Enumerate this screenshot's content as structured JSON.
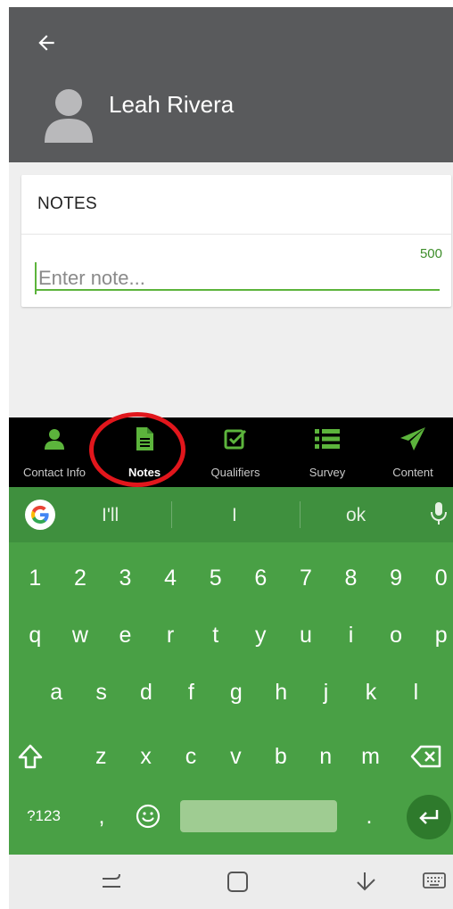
{
  "header": {
    "contact_name": "Leah Rivera"
  },
  "notes": {
    "title": "NOTES",
    "char_count": "500",
    "placeholder": "Enter note..."
  },
  "bottom_nav": [
    {
      "label": "Contact Info",
      "icon": "person-icon",
      "active": false
    },
    {
      "label": "Notes",
      "icon": "document-icon",
      "active": true
    },
    {
      "label": "Qualifiers",
      "icon": "checkbox-icon",
      "active": false
    },
    {
      "label": "Survey",
      "icon": "list-icon",
      "active": false
    },
    {
      "label": "Content",
      "icon": "send-icon",
      "active": false
    }
  ],
  "keyboard": {
    "suggestions": [
      "I'll",
      "I",
      "ok"
    ],
    "number_row": [
      "1",
      "2",
      "3",
      "4",
      "5",
      "6",
      "7",
      "8",
      "9",
      "0"
    ],
    "row1": [
      "q",
      "w",
      "e",
      "r",
      "t",
      "y",
      "u",
      "i",
      "o",
      "p"
    ],
    "row2": [
      "a",
      "s",
      "d",
      "f",
      "g",
      "h",
      "j",
      "k",
      "l"
    ],
    "row3": [
      "z",
      "x",
      "c",
      "v",
      "b",
      "n",
      "m"
    ],
    "symbols_key": "?123",
    "comma_key": ",",
    "period_key": "."
  },
  "colors": {
    "header_bg": "#595a5c",
    "accent_green": "#5cb43c",
    "keyboard_bg": "#49a045",
    "highlight_red": "#e1161c"
  }
}
